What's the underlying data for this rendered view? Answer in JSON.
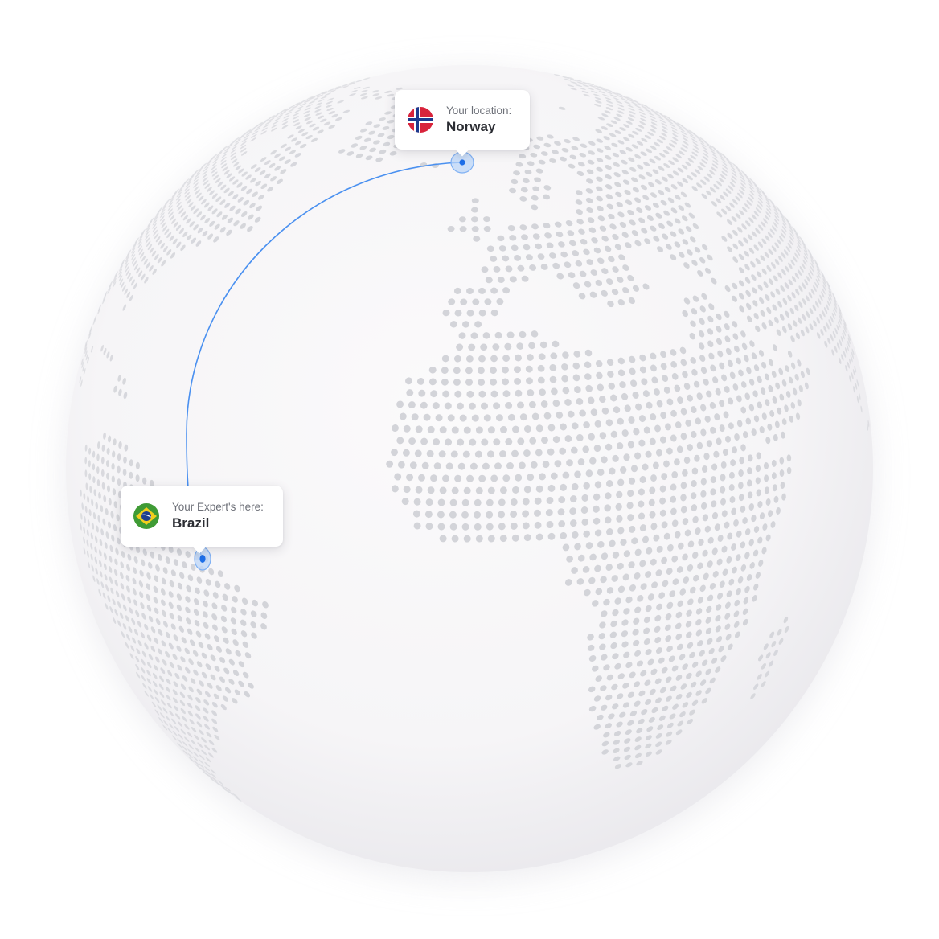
{
  "map": {
    "type": "dotted-globe",
    "projection": "orthographic",
    "center_view": {
      "lat": 16,
      "lon": -5
    },
    "colors": {
      "background": "#ffffff",
      "globe_fill": "#f6f5f7",
      "globe_edge_shade": "#e9e8ec",
      "land_dot": "#d3d4d9",
      "route_line": "#4a90f0",
      "marker_ring": "#bcd5f8",
      "marker_ring_stroke": "#7fb0f3",
      "marker_dot": "#1e6fe8"
    }
  },
  "route": {
    "from": "norway",
    "to": "brazil"
  },
  "locations": {
    "norway": {
      "caption": "Your location:",
      "country": "Norway",
      "flag_icon": "norway-flag-icon",
      "flag_colors": {
        "red": "#d8233b",
        "white": "#ffffff",
        "blue": "#1d3a8f"
      },
      "lat": 59.9,
      "lon": 10.7
    },
    "brazil": {
      "caption": "Your Expert's here:",
      "country": "Brazil",
      "flag_icon": "brazil-flag-icon",
      "flag_colors": {
        "green": "#3f9b35",
        "yellow": "#f2cf1d",
        "blue": "#1e3f8f",
        "white": "#ffffff"
      },
      "lat": 5.0,
      "lon": -60.0
    }
  }
}
